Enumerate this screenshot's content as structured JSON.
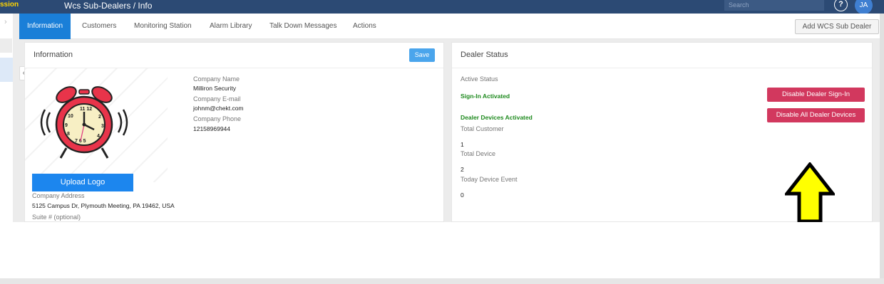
{
  "header": {
    "brand": "ssion",
    "title": "Wcs Sub-Dealers / Info",
    "search_placeholder": "Search",
    "help_symbol": "?",
    "avatar_initials": "JA"
  },
  "tabs": [
    {
      "label": "Information"
    },
    {
      "label": "Customers"
    },
    {
      "label": "Monitoring Station"
    },
    {
      "label": "Alarm Library"
    },
    {
      "label": "Talk Down Messages"
    },
    {
      "label": "Actions"
    }
  ],
  "add_button": "Add WCS Sub Dealer",
  "info_panel": {
    "title": "Information",
    "save_label": "Save",
    "upload_label": "Upload Logo",
    "company_name_label": "Company Name",
    "company_name": "Milliron Security",
    "company_email_label": "Company E-mail",
    "company_email": "johnm@chekt.com",
    "company_phone_label": "Company Phone",
    "company_phone": "12158969944",
    "company_address_label": "Company Address",
    "company_address": "5125 Campus Dr, Plymouth Meeting, PA 19462, USA",
    "suite_label": "Suite # (optional)"
  },
  "status_panel": {
    "title": "Dealer Status",
    "active_status_label": "Active Status",
    "sign_in_status": "Sign-In Activated",
    "devices_status": "Dealer Devices Activated",
    "total_customer_label": "Total Customer",
    "total_customer": "1",
    "total_device_label": "Total Device",
    "total_device": "2",
    "today_event_label": "Today Device Event",
    "today_event": "0",
    "disable_signin_label": "Disable Dealer Sign-In",
    "disable_devices_label": "Disable All Dealer Devices"
  },
  "colors": {
    "topbar": "#2c4a74",
    "active_tab": "#1a7fd8",
    "danger": "#d2385e",
    "status_green": "#1e8a1e",
    "arrow_yellow": "#ffff00"
  }
}
